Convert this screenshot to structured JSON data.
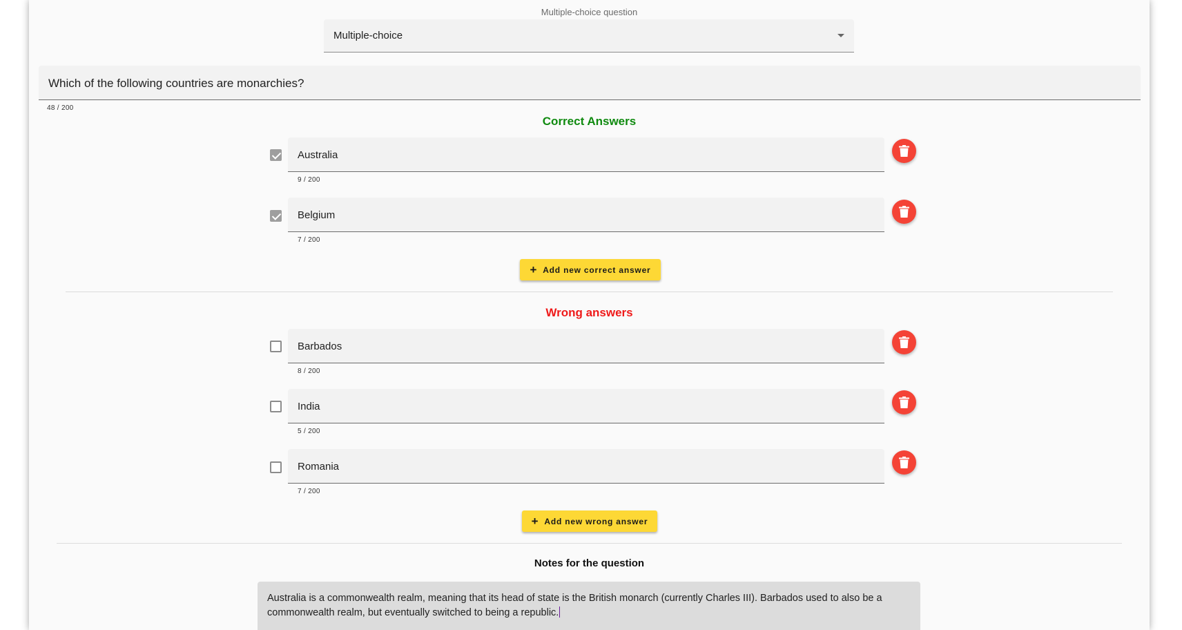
{
  "question_type": {
    "label": "Multiple-choice question",
    "selected": "Multiple-choice"
  },
  "question": {
    "text": "Which of the following countries are monarchies?",
    "counter": "48 / 200"
  },
  "correct_section": {
    "title": "Correct Answers",
    "answers": [
      {
        "text": "Australia",
        "counter": "9 / 200",
        "checked": true
      },
      {
        "text": "Belgium",
        "counter": "7 / 200",
        "checked": true
      }
    ],
    "add_label": "Add new correct answer"
  },
  "wrong_section": {
    "title": "Wrong answers",
    "answers": [
      {
        "text": "Barbados",
        "counter": "8 / 200",
        "checked": false
      },
      {
        "text": "India",
        "counter": "5 / 200",
        "checked": false
      },
      {
        "text": "Romania",
        "counter": "7 / 200",
        "checked": false
      }
    ],
    "add_label": "Add new wrong answer"
  },
  "notes": {
    "title": "Notes for the question",
    "text": "Australia is a commonwealth realm, meaning that its head of state is the British monarch (currently Charles III). Barbados used to also be a commonwealth realm, but eventually switched to being a republic."
  },
  "colors": {
    "correct_title": "#0f8a0f",
    "wrong_title": "#ef1a1a",
    "delete_button": "#f44336",
    "add_button": "#fdd835"
  },
  "icons": {
    "delete": "trash-icon",
    "add": "plus-icon",
    "dropdown": "caret-down-icon",
    "check": "checkbox-icon"
  }
}
